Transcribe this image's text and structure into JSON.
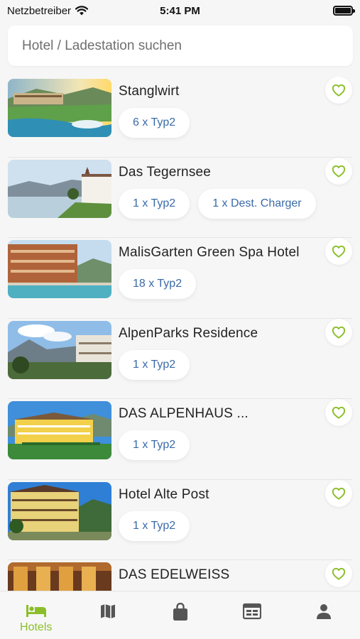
{
  "status_bar": {
    "carrier": "Netzbetreiber",
    "time": "5:41 PM"
  },
  "search": {
    "placeholder": "Hotel / Ladestation suchen"
  },
  "colors": {
    "accent": "#8bbf2a",
    "chip_text": "#3a6aa8",
    "tab_icon_inactive": "#555555"
  },
  "hotels": [
    {
      "name": "Stanglwirt",
      "chargers": [
        "6 x Typ2"
      ],
      "favorite": false
    },
    {
      "name": "Das Tegernsee",
      "chargers": [
        "1 x Typ2",
        "1 x Dest. Charger"
      ],
      "favorite": false
    },
    {
      "name": "MalisGarten Green Spa Hotel",
      "chargers": [
        "18 x Typ2"
      ],
      "favorite": false
    },
    {
      "name": "AlpenParks Residence",
      "chargers": [
        "1 x Typ2"
      ],
      "favorite": false
    },
    {
      "name": "DAS ALPENHAUS ...",
      "chargers": [
        "1 x Typ2"
      ],
      "favorite": false
    },
    {
      "name": "Hotel Alte Post",
      "chargers": [
        "1 x Typ2"
      ],
      "favorite": false
    },
    {
      "name": "DAS EDELWEISS",
      "chargers": [],
      "favorite": false
    }
  ],
  "tabbar": {
    "tabs": [
      {
        "icon": "bed-icon",
        "label": "Hotels",
        "active": true
      },
      {
        "icon": "map-icon",
        "label": "",
        "active": false
      },
      {
        "icon": "shopping-bag-icon",
        "label": "",
        "active": false
      },
      {
        "icon": "calendar-icon",
        "label": "",
        "active": false
      },
      {
        "icon": "user-icon",
        "label": "",
        "active": false
      }
    ]
  }
}
